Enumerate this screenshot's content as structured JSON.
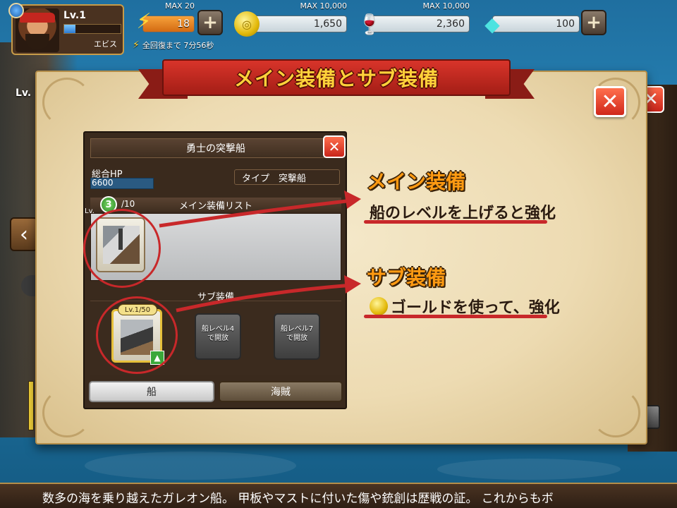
{
  "hud": {
    "level": "Lv.1",
    "player_name": "エビス",
    "exp_fill": 0.2,
    "energy": {
      "max": "MAX 20",
      "value": "18"
    },
    "gold": {
      "max": "MAX 10,000",
      "value": "1,650"
    },
    "wine": {
      "max": "MAX 10,000",
      "value": "2,360"
    },
    "gems": {
      "value": "100"
    },
    "plus": "+",
    "timer": "全回復まで 7分56秒",
    "icons": {
      "energy": "lightning-icon",
      "gold": "gold-coin-icon",
      "wine": "wine-glass-icon",
      "gem": "gem-icon"
    }
  },
  "background": {
    "behind_level": "Lv."
  },
  "panel": {
    "title": "メイン装備とサブ装備",
    "close": "✕",
    "ship_name": "勇士の突撃船",
    "hp_label": "総合HP",
    "hp_value": "6600",
    "type": "タイプ　突撃船",
    "main_count": "3",
    "main_max": "/10",
    "main_list_title": "メイン装備リスト",
    "lv_small": "Lv.",
    "sub_title": "サブ装備",
    "sub_slot_level": "Lv.1/50",
    "locked_a": "船レベル4\nで開放",
    "locked_b": "船レベル7\nで開放",
    "tab_ship": "船",
    "tab_pirate": "海賊"
  },
  "callouts": {
    "main_title": "メイン装備",
    "main_text": "船のレベルを上げると強化",
    "sub_title": "サブ装備",
    "sub_text": "ゴールドを使って、強化"
  },
  "ticker": "数多の海を乗り越えたガレオン船。 甲板やマストに付いた傷や銃創は歴戦の証。 これからもボ",
  "colors": {
    "accent_red": "#c8282a",
    "callout_orange": "#ff9a12",
    "parchment": "#f4e8c9",
    "ribbon": "#d8342a"
  }
}
